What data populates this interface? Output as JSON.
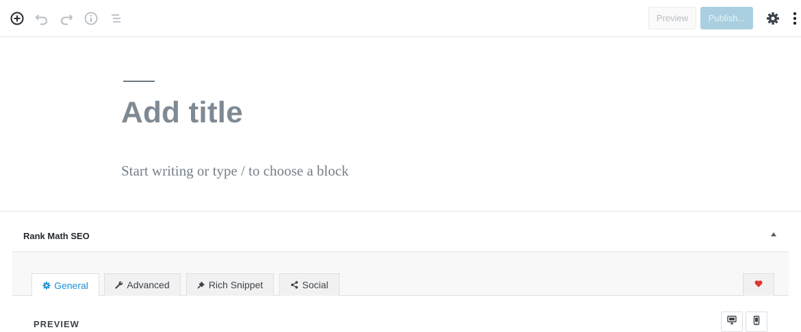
{
  "toolbar": {
    "icons": [
      "add-block-icon",
      "undo-icon",
      "redo-icon",
      "info-icon",
      "outline-icon",
      "settings-gear-icon",
      "more-options-icon"
    ],
    "preview_label": "Preview",
    "publish_label": "Publish..."
  },
  "editor": {
    "title_placeholder": "Add title",
    "block_placeholder": "Start writing or type / to choose a block"
  },
  "metabox": {
    "title": "Rank Math SEO",
    "tabs": [
      {
        "label": "General",
        "icon": "gear-icon",
        "active": true
      },
      {
        "label": "Advanced",
        "icon": "wrench-icon",
        "active": false
      },
      {
        "label": "Rich Snippet",
        "icon": "pin-icon",
        "active": false
      },
      {
        "label": "Social",
        "icon": "share-icon",
        "active": false
      }
    ],
    "heart_icon": "heart-icon",
    "preview_label": "PREVIEW",
    "device_buttons": [
      "desktop-icon",
      "mobile-icon"
    ]
  },
  "colors": {
    "accent": "#1a8fd3",
    "publish_bg": "#a9cfe0",
    "heart": "#e2352b"
  }
}
